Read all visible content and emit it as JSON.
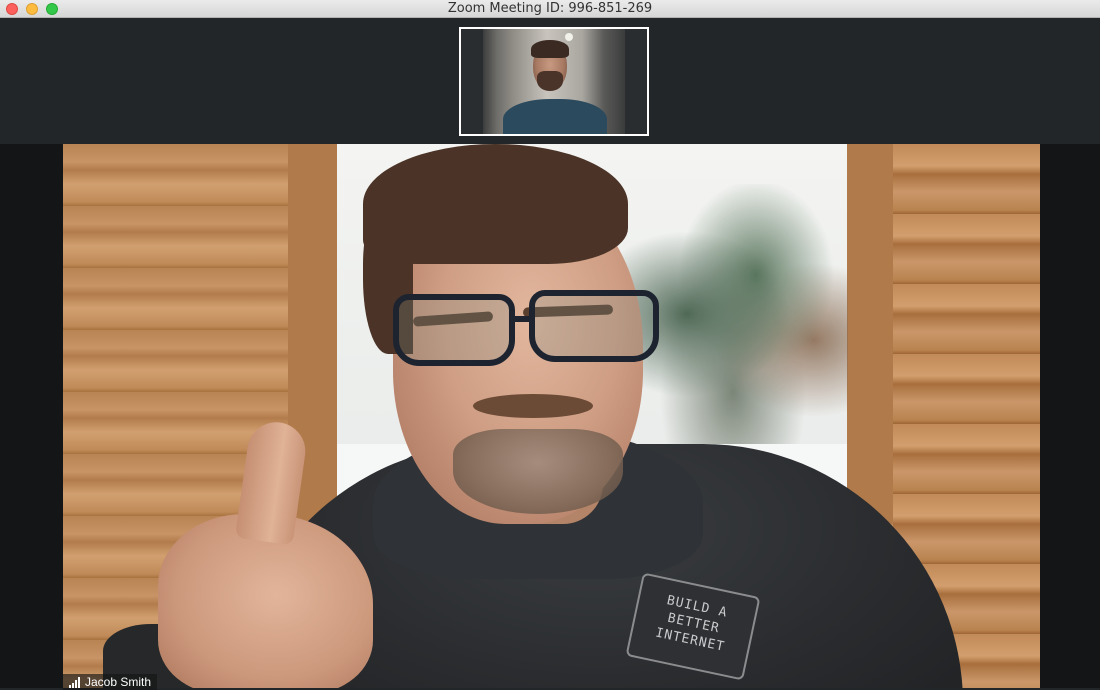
{
  "window": {
    "title": "Zoom Meeting ID: 996-851-269",
    "controls": [
      "close",
      "minimize",
      "zoom"
    ]
  },
  "thumbnail_strip": {
    "participant_tiles": 1,
    "active_tile_border_color": "#ffffff"
  },
  "main_video": {
    "speaker_name": "Jacob Smith",
    "signal_icon": "signal-strength-icon",
    "shirt_logo_text": "BUILD A BETTER INTERNET"
  },
  "colors": {
    "titlebar_bg": "#dcdcdc",
    "app_bg": "#232629",
    "close": "#fc605c",
    "minimize": "#fdbc40",
    "zoom": "#34c84a"
  }
}
